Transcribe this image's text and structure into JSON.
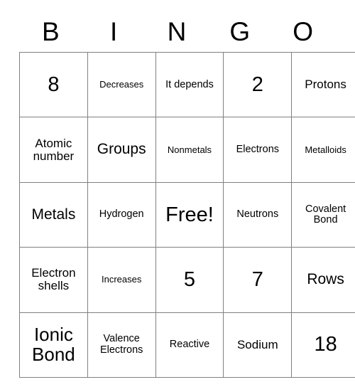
{
  "card": {
    "headers": [
      "B",
      "I",
      "N",
      "G",
      "O"
    ],
    "rows": [
      [
        {
          "text": "8",
          "size": "fs-xxl"
        },
        {
          "text": "Decreases",
          "size": "fs-xs"
        },
        {
          "text": "It depends",
          "size": "fs-s"
        },
        {
          "text": "2",
          "size": "fs-xxl"
        },
        {
          "text": "Protons",
          "size": "fs-m"
        }
      ],
      [
        {
          "text": "Atomic number",
          "size": "fs-m"
        },
        {
          "text": "Groups",
          "size": "fs-l"
        },
        {
          "text": "Nonmetals",
          "size": "fs-xs"
        },
        {
          "text": "Electrons",
          "size": "fs-s"
        },
        {
          "text": "Metalloids",
          "size": "fs-xs"
        }
      ],
      [
        {
          "text": "Metals",
          "size": "fs-l"
        },
        {
          "text": "Hydrogen",
          "size": "fs-s"
        },
        {
          "text": "Free!",
          "size": "fs-xxl"
        },
        {
          "text": "Neutrons",
          "size": "fs-s"
        },
        {
          "text": "Covalent Bond",
          "size": "fs-s"
        }
      ],
      [
        {
          "text": "Electron shells",
          "size": "fs-m"
        },
        {
          "text": "Increases",
          "size": "fs-xs"
        },
        {
          "text": "5",
          "size": "fs-xxl"
        },
        {
          "text": "7",
          "size": "fs-xxl"
        },
        {
          "text": "Rows",
          "size": "fs-l"
        }
      ],
      [
        {
          "text": "Ionic Bond",
          "size": "fs-xl"
        },
        {
          "text": "Valence Electrons",
          "size": "fs-s"
        },
        {
          "text": "Reactive",
          "size": "fs-s"
        },
        {
          "text": "Sodium",
          "size": "fs-m"
        },
        {
          "text": "18",
          "size": "fs-xxl"
        }
      ]
    ]
  },
  "colors": {
    "border": "#808080",
    "text": "#000000",
    "background": "#ffffff"
  }
}
